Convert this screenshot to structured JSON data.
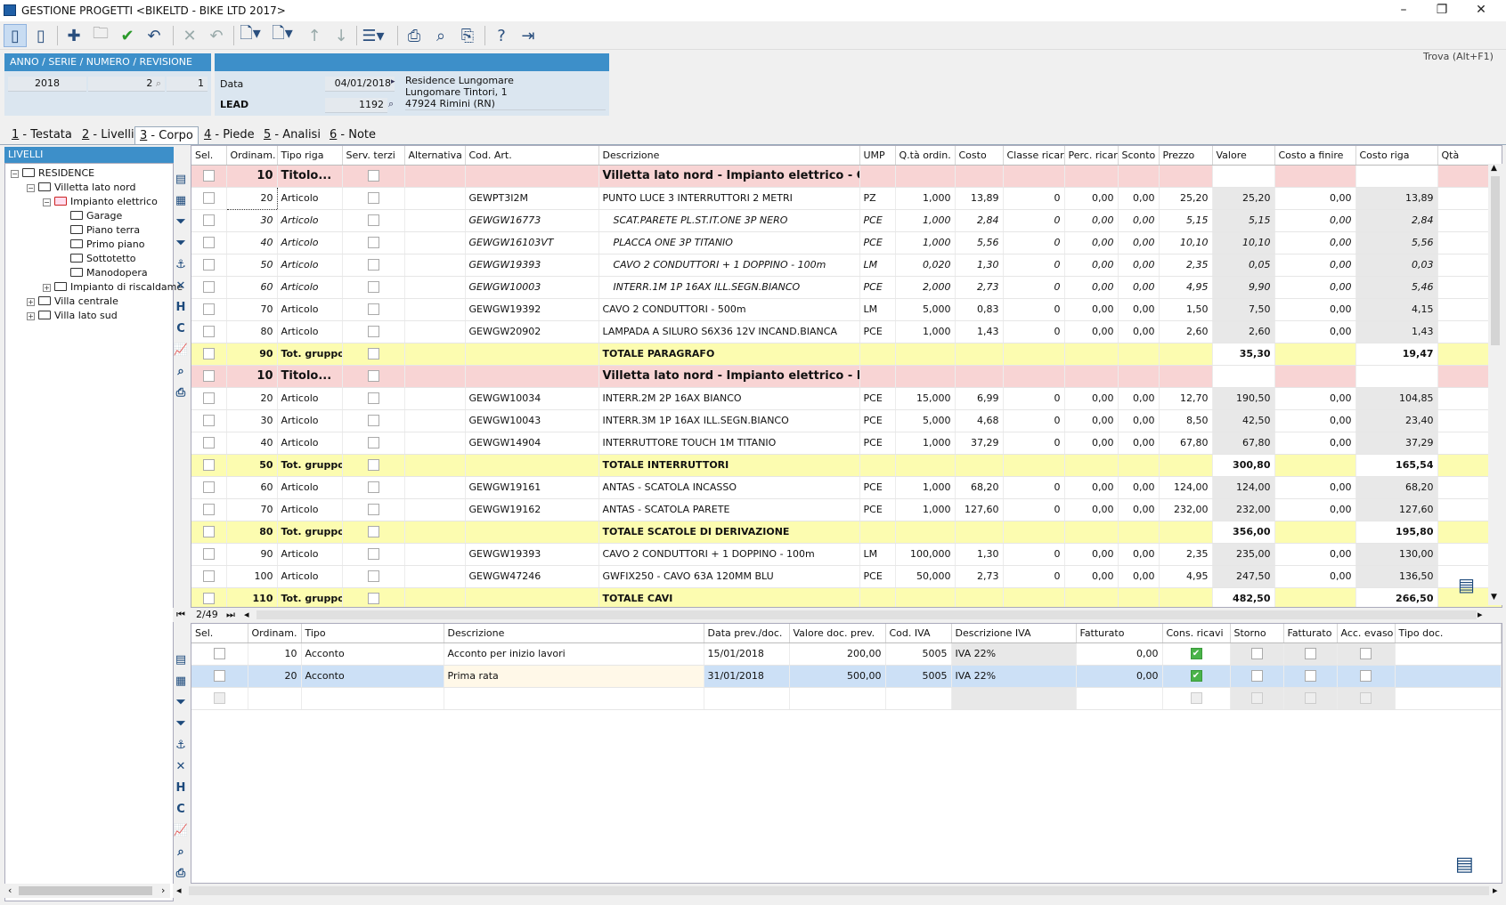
{
  "window": {
    "title": "GESTIONE PROGETTI <BIKELTD - BIKE LTD 2017>",
    "min": "–",
    "max": "❐",
    "close": "✕"
  },
  "toolbar": {
    "search": "Trova (Alt+F1)"
  },
  "header": {
    "left_title": "ANNO / SERIE / NUMERO / REVISIONE",
    "anno": "2018",
    "serie": "",
    "numero": "2",
    "revisione": "1",
    "data_label": "Data",
    "data_value": "04/01/2018",
    "lead_label": "LEAD",
    "lead_value": "1192",
    "address": [
      "Residence Lungomare",
      "Lungomare Tintori, 1",
      "47924 Rimini (RN)"
    ]
  },
  "tabs": [
    {
      "num": "1",
      "label": " - Testata"
    },
    {
      "num": "2",
      "label": " - Livelli"
    },
    {
      "num": "3",
      "label": " - Corpo"
    },
    {
      "num": "4",
      "label": " - Piede"
    },
    {
      "num": "5",
      "label": " - Analisi"
    },
    {
      "num": "6",
      "label": " - Note"
    }
  ],
  "tree": {
    "title": "LIVELLI",
    "nodes": [
      {
        "label": "RESIDENCE",
        "depth": 0,
        "pm": "−"
      },
      {
        "label": "Villetta lato nord",
        "depth": 1,
        "pm": "−"
      },
      {
        "label": "Impianto elettrico",
        "depth": 2,
        "pm": "−",
        "red": true
      },
      {
        "label": "Garage",
        "depth": 3
      },
      {
        "label": "Piano terra",
        "depth": 3
      },
      {
        "label": "Primo piano",
        "depth": 3
      },
      {
        "label": "Sottotetto",
        "depth": 3
      },
      {
        "label": "Manodopera",
        "depth": 3
      },
      {
        "label": "Impianto di riscaldame",
        "depth": 2,
        "pm": "+"
      },
      {
        "label": "Villa centrale",
        "depth": 1,
        "pm": "+"
      },
      {
        "label": "Villa lato sud",
        "depth": 1,
        "pm": "+"
      }
    ]
  },
  "grid1": {
    "columns": [
      "Sel.",
      "Ordinam.",
      "Tipo riga",
      "Serv. terzi",
      "Alternativa",
      "Cod. Art.",
      "Descrizione",
      "UMP",
      "Q.tà ordin.",
      "Costo",
      "Classe ricar.",
      "Perc. ricar",
      "Sconto",
      "Prezzo",
      "Valore",
      "Costo a finire",
      "Costo riga",
      "Qtà"
    ],
    "rows": [
      {
        "k": "tit",
        "ord": "10",
        "tipo": "Titolo...",
        "cod": "",
        "desc": "Villetta lato nord - Impianto elettrico - Garage",
        "ump": "",
        "qta": "",
        "costo": "",
        "cl": "",
        "perc": "",
        "sc": "",
        "prezzo": "",
        "valore": "",
        "cfin": "",
        "criga": ""
      },
      {
        "k": "art",
        "ord": "20",
        "tipo": "Articolo",
        "cod": "GEWPT3I2M",
        "desc": "PUNTO LUCE 3 INTERRUTTORI 2 METRI",
        "ump": "PZ",
        "qta": "1,000",
        "costo": "13,89",
        "cl": "0",
        "perc": "0,00",
        "sc": "0,00",
        "prezzo": "25,20",
        "valore": "25,20",
        "cfin": "0,00",
        "criga": "13,89"
      },
      {
        "k": "sub",
        "ord": "30",
        "tipo": "Articolo",
        "cod": "GEWGW16773",
        "desc": "SCAT.PARETE PL.ST.IT.ONE 3P NERO",
        "ump": "PCE",
        "qta": "1,000",
        "costo": "2,84",
        "cl": "0",
        "perc": "0,00",
        "sc": "0,00",
        "prezzo": "5,15",
        "valore": "5,15",
        "cfin": "0,00",
        "criga": "2,84"
      },
      {
        "k": "sub",
        "ord": "40",
        "tipo": "Articolo",
        "cod": "GEWGW16103VT",
        "desc": "PLACCA ONE 3P TITANIO",
        "ump": "PCE",
        "qta": "1,000",
        "costo": "5,56",
        "cl": "0",
        "perc": "0,00",
        "sc": "0,00",
        "prezzo": "10,10",
        "valore": "10,10",
        "cfin": "0,00",
        "criga": "5,56"
      },
      {
        "k": "sub",
        "ord": "50",
        "tipo": "Articolo",
        "cod": "GEWGW19393",
        "desc": "CAVO 2 CONDUTTORI + 1 DOPPINO - 100m",
        "ump": "LM",
        "qta": "0,020",
        "costo": "1,30",
        "cl": "0",
        "perc": "0,00",
        "sc": "0,00",
        "prezzo": "2,35",
        "valore": "0,05",
        "cfin": "0,00",
        "criga": "0,03"
      },
      {
        "k": "sub",
        "ord": "60",
        "tipo": "Articolo",
        "cod": "GEWGW10003",
        "desc": "INTERR.1M 1P 16AX ILL.SEGN.BIANCO",
        "ump": "PCE",
        "qta": "2,000",
        "costo": "2,73",
        "cl": "0",
        "perc": "0,00",
        "sc": "0,00",
        "prezzo": "4,95",
        "valore": "9,90",
        "cfin": "0,00",
        "criga": "5,46"
      },
      {
        "k": "art",
        "ord": "70",
        "tipo": "Articolo",
        "cod": "GEWGW19392",
        "desc": "CAVO 2 CONDUTTORI - 500m",
        "ump": "LM",
        "qta": "5,000",
        "costo": "0,83",
        "cl": "0",
        "perc": "0,00",
        "sc": "0,00",
        "prezzo": "1,50",
        "valore": "7,50",
        "cfin": "0,00",
        "criga": "4,15"
      },
      {
        "k": "art",
        "ord": "80",
        "tipo": "Articolo",
        "cod": "GEWGW20902",
        "desc": "LAMPADA A SILURO S6X36 12V INCAND.BIANCA",
        "ump": "PCE",
        "qta": "1,000",
        "costo": "1,43",
        "cl": "0",
        "perc": "0,00",
        "sc": "0,00",
        "prezzo": "2,60",
        "valore": "2,60",
        "cfin": "0,00",
        "criga": "1,43"
      },
      {
        "k": "tot",
        "ord": "90",
        "tipo": "Tot. gruppo",
        "cod": "",
        "desc": "TOTALE PARAGRAFO",
        "ump": "",
        "qta": "",
        "costo": "",
        "cl": "",
        "perc": "",
        "sc": "",
        "prezzo": "",
        "valore": "35,30",
        "cfin": "",
        "criga": "19,47"
      },
      {
        "k": "tit",
        "ord": "10",
        "tipo": "Titolo...",
        "cod": "",
        "desc": "Villetta lato nord - Impianto elettrico - Piano ...",
        "ump": "",
        "qta": "",
        "costo": "",
        "cl": "",
        "perc": "",
        "sc": "",
        "prezzo": "",
        "valore": "",
        "cfin": "",
        "criga": ""
      },
      {
        "k": "art",
        "ord": "20",
        "tipo": "Articolo",
        "cod": "GEWGW10034",
        "desc": "INTERR.2M 2P 16AX BIANCO",
        "ump": "PCE",
        "qta": "15,000",
        "costo": "6,99",
        "cl": "0",
        "perc": "0,00",
        "sc": "0,00",
        "prezzo": "12,70",
        "valore": "190,50",
        "cfin": "0,00",
        "criga": "104,85"
      },
      {
        "k": "art",
        "ord": "30",
        "tipo": "Articolo",
        "cod": "GEWGW10043",
        "desc": "INTERR.3M 1P 16AX ILL.SEGN.BIANCO",
        "ump": "PCE",
        "qta": "5,000",
        "costo": "4,68",
        "cl": "0",
        "perc": "0,00",
        "sc": "0,00",
        "prezzo": "8,50",
        "valore": "42,50",
        "cfin": "0,00",
        "criga": "23,40"
      },
      {
        "k": "art",
        "ord": "40",
        "tipo": "Articolo",
        "cod": "GEWGW14904",
        "desc": "INTERRUTTORE TOUCH 1M TITANIO",
        "ump": "PCE",
        "qta": "1,000",
        "costo": "37,29",
        "cl": "0",
        "perc": "0,00",
        "sc": "0,00",
        "prezzo": "67,80",
        "valore": "67,80",
        "cfin": "0,00",
        "criga": "37,29"
      },
      {
        "k": "tot",
        "ord": "50",
        "tipo": "Tot. gruppo",
        "cod": "",
        "desc": "TOTALE INTERRUTTORI",
        "ump": "",
        "qta": "",
        "costo": "",
        "cl": "",
        "perc": "",
        "sc": "",
        "prezzo": "",
        "valore": "300,80",
        "cfin": "",
        "criga": "165,54"
      },
      {
        "k": "art",
        "ord": "60",
        "tipo": "Articolo",
        "cod": "GEWGW19161",
        "desc": "ANTAS - SCATOLA INCASSO",
        "ump": "PCE",
        "qta": "1,000",
        "costo": "68,20",
        "cl": "0",
        "perc": "0,00",
        "sc": "0,00",
        "prezzo": "124,00",
        "valore": "124,00",
        "cfin": "0,00",
        "criga": "68,20"
      },
      {
        "k": "art",
        "ord": "70",
        "tipo": "Articolo",
        "cod": "GEWGW19162",
        "desc": "ANTAS - SCATOLA PARETE",
        "ump": "PCE",
        "qta": "1,000",
        "costo": "127,60",
        "cl": "0",
        "perc": "0,00",
        "sc": "0,00",
        "prezzo": "232,00",
        "valore": "232,00",
        "cfin": "0,00",
        "criga": "127,60"
      },
      {
        "k": "tot",
        "ord": "80",
        "tipo": "Tot. gruppo",
        "cod": "",
        "desc": "TOTALE SCATOLE DI DERIVAZIONE",
        "ump": "",
        "qta": "",
        "costo": "",
        "cl": "",
        "perc": "",
        "sc": "",
        "prezzo": "",
        "valore": "356,00",
        "cfin": "",
        "criga": "195,80"
      },
      {
        "k": "art",
        "ord": "90",
        "tipo": "Articolo",
        "cod": "GEWGW19393",
        "desc": "CAVO 2 CONDUTTORI + 1 DOPPINO - 100m",
        "ump": "LM",
        "qta": "100,000",
        "costo": "1,30",
        "cl": "0",
        "perc": "0,00",
        "sc": "0,00",
        "prezzo": "2,35",
        "valore": "235,00",
        "cfin": "0,00",
        "criga": "130,00"
      },
      {
        "k": "art",
        "ord": "100",
        "tipo": "Articolo",
        "cod": "GEWGW47246",
        "desc": "GWFIX250 - CAVO 63A 120MM BLU",
        "ump": "PCE",
        "qta": "50,000",
        "costo": "2,73",
        "cl": "0",
        "perc": "0,00",
        "sc": "0,00",
        "prezzo": "4,95",
        "valore": "247,50",
        "cfin": "0,00",
        "criga": "136,50"
      },
      {
        "k": "tot",
        "ord": "110",
        "tipo": "Tot. gruppo",
        "cod": "",
        "desc": "TOTALE CAVI",
        "ump": "",
        "qta": "",
        "costo": "",
        "cl": "",
        "perc": "",
        "sc": "",
        "prezzo": "",
        "valore": "482,50",
        "cfin": "",
        "criga": "266,50"
      }
    ]
  },
  "pager": {
    "position": "2/49"
  },
  "grid2": {
    "columns": [
      "Sel.",
      "Ordinam.",
      "Tipo",
      "Descrizione",
      "Data prev./doc.",
      "Valore doc. prev.",
      "Cod. IVA",
      "Descrizione IVA",
      "Fatturato",
      "Cons. ricavi",
      "Storno",
      "Fatturato",
      "Acc. evaso",
      "Tipo doc."
    ],
    "rows": [
      {
        "ord": "10",
        "tipo": "Acconto",
        "desc": "Acconto per inizio lavori",
        "data": "15/01/2018",
        "valore": "200,00",
        "iva": "5005",
        "desciva": "IVA 22%",
        "fatt": "0,00"
      },
      {
        "ord": "20",
        "tipo": "Acconto",
        "desc": "Prima rata",
        "data": "31/01/2018",
        "valore": "500,00",
        "iva": "5005",
        "desciva": "IVA 22%",
        "fatt": "0,00"
      }
    ]
  }
}
